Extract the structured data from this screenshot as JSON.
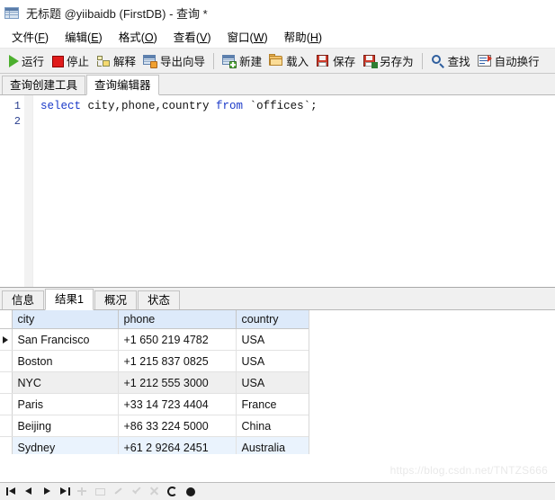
{
  "window": {
    "title": "无标题 @yiibaidb (FirstDB) - 查询 *",
    "icon": "table-grid-icon"
  },
  "menubar": {
    "items": [
      {
        "text": "文件",
        "mnemonic": "F"
      },
      {
        "text": "编辑",
        "mnemonic": "E"
      },
      {
        "text": "格式",
        "mnemonic": "O"
      },
      {
        "text": "查看",
        "mnemonic": "V"
      },
      {
        "text": "窗口",
        "mnemonic": "W"
      },
      {
        "text": "帮助",
        "mnemonic": "H"
      }
    ]
  },
  "toolbar": {
    "buttons": [
      {
        "label": "运行",
        "icon": "play-icon"
      },
      {
        "label": "停止",
        "icon": "stop-icon"
      },
      {
        "label": "解释",
        "icon": "explain-icon"
      },
      {
        "label": "导出向导",
        "icon": "export-wizard-icon"
      },
      {
        "label": "新建",
        "icon": "new-query-icon"
      },
      {
        "label": "载入",
        "icon": "folder-open-icon"
      },
      {
        "label": "保存",
        "icon": "save-icon"
      },
      {
        "label": "另存为",
        "icon": "save-as-icon"
      },
      {
        "label": "查找",
        "icon": "search-icon"
      },
      {
        "label": "自动换行",
        "icon": "word-wrap-icon"
      }
    ]
  },
  "editor_tabs": [
    {
      "label": "查询创建工具",
      "active": false
    },
    {
      "label": "查询编辑器",
      "active": true
    }
  ],
  "editor": {
    "line_numbers": [
      "1",
      "2"
    ],
    "sql": {
      "kw_select": "select",
      "columns": " city,phone,country ",
      "kw_from": "from",
      "table": " `offices`;"
    }
  },
  "result_tabs": [
    {
      "label": "信息",
      "active": false
    },
    {
      "label": "结果1",
      "active": true
    },
    {
      "label": "概况",
      "active": false
    },
    {
      "label": "状态",
      "active": false
    }
  ],
  "grid": {
    "columns": [
      "city",
      "phone",
      "country"
    ],
    "rows": [
      {
        "city": "San Francisco",
        "phone": "+1 650 219 4782",
        "country": "USA",
        "current": true,
        "state": "normal"
      },
      {
        "city": "Boston",
        "phone": "+1 215 837 0825",
        "country": "USA",
        "current": false,
        "state": "normal"
      },
      {
        "city": "NYC",
        "phone": "+1 212 555 3000",
        "country": "USA",
        "current": false,
        "state": "hover"
      },
      {
        "city": "Paris",
        "phone": "+33 14 723 4404",
        "country": "France",
        "current": false,
        "state": "normal"
      },
      {
        "city": "Beijing",
        "phone": "+86 33 224 5000",
        "country": "China",
        "current": false,
        "state": "normal"
      },
      {
        "city": "Sydney",
        "phone": "+61 2 9264 2451",
        "country": "Australia",
        "current": false,
        "state": "selected"
      }
    ]
  },
  "navbar": {
    "buttons": [
      {
        "name": "first-record-button",
        "icon": "first-icon"
      },
      {
        "name": "previous-record-button",
        "icon": "previous-icon"
      },
      {
        "name": "next-record-button",
        "icon": "next-icon"
      },
      {
        "name": "last-record-button",
        "icon": "last-icon"
      },
      {
        "name": "insert-record-button",
        "icon": "plus-icon"
      },
      {
        "name": "delete-record-button",
        "icon": "minus-icon"
      },
      {
        "name": "edit-record-button",
        "icon": "pencil-icon"
      },
      {
        "name": "apply-changes-button",
        "icon": "check-icon"
      },
      {
        "name": "cancel-changes-button",
        "icon": "x-icon"
      },
      {
        "name": "refresh-button",
        "icon": "refresh-icon"
      },
      {
        "name": "stop-loading-button",
        "icon": "stop-circle-icon"
      }
    ]
  },
  "watermark": "https://blog.csdn.net/TNTZS666",
  "colors": {
    "accent_header": "#ddeafa",
    "selection": "#eaf3fd",
    "keyword": "#1a39c8",
    "line_number": "#2a3f8f",
    "toolbar_bg": "#f0f0f0"
  }
}
